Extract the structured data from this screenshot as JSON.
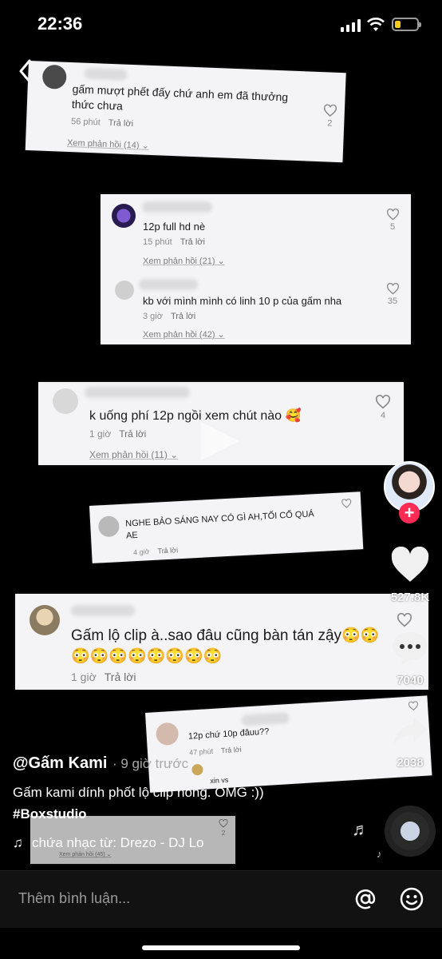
{
  "status_bar": {
    "time": "22:36"
  },
  "comments": [
    {
      "text": "gấm mượt phết đấy chứ anh em đã thưởng thức chưa",
      "time": "56 phút",
      "reply": "Trả lời",
      "likes": "2",
      "view_replies": "Xem phản hồi (14)"
    },
    {
      "text": "12p full hd nè",
      "time": "15 phút",
      "reply": "Trả lời",
      "likes": "5",
      "view_replies": "Xem phản hồi (21)"
    },
    {
      "text": "kb với mình mình có linh 10 p của gấm nha",
      "time": "3 giờ",
      "reply": "Trả lời",
      "likes": "35",
      "view_replies": "Xem phản hồi (42)"
    },
    {
      "text": "k uống phí 12p ngồi xem chút nào 🥰",
      "time": "1 giờ",
      "reply": "Trả lời",
      "likes": "4",
      "view_replies": "Xem phản hồi (11)"
    },
    {
      "text": "NGHE BẢO SÁNG NAY CÓ GÌ AH,TỐI CỐ QUÁ AE",
      "time": "4 giờ",
      "reply": "Trả lời",
      "likes": ""
    },
    {
      "text": "Gấm lộ clip à..sao đâu cũng bàn tán zậy😳😳",
      "text2": "😳😳😳😳😳😳😳😳",
      "time": "1 giờ",
      "reply": "Trả lời"
    },
    {
      "text": "12p chứ 10p đâuu??",
      "time": "47 phút",
      "reply": "Trả lời",
      "sub_text": "xin vs"
    },
    {
      "view_replies": "Xem phản hồi (45)",
      "likes": "2"
    }
  ],
  "actions": {
    "likes": "527.8K",
    "comments": "7040",
    "shares": "2038"
  },
  "video": {
    "username": "@Gấm Kami",
    "time_ago": "· 9 giờ trước",
    "caption": "Gấm kami dính phốt lộ clip nóng. OMG :))",
    "hashtag": "#Boxstudio",
    "music": "chứa nhạc từ: Drezo - DJ Lo"
  },
  "comment_bar": {
    "placeholder": "Thêm bình luận..."
  },
  "colors": {
    "follow_plus": "#fe2c55",
    "battery": "#f5cb1b",
    "card_bg": "#f4f4f6"
  }
}
